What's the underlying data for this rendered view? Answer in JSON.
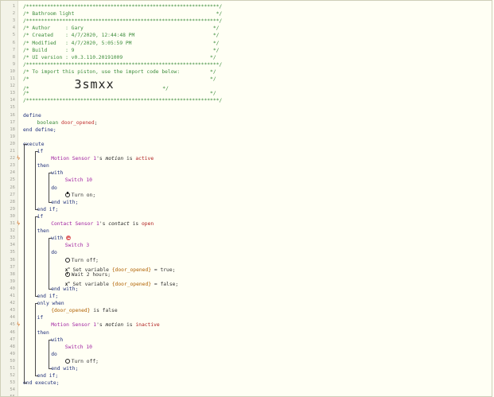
{
  "header": {
    "stars": "/****************************************************************/",
    "title": "/* Bathroom light                                               */",
    "author": "/* Author     : Gary                                           */",
    "created": "/* Created    : 4/7/2020, 12:44:48 PM                          */",
    "modified": "/* Modified   : 4/7/2020, 5:05:59 PM                           */",
    "build": "/* Build      : 9                                              */",
    "ui_version": "/* UI version : v0.3.110.20191009                             */",
    "import_note": "/* To import this piston, use the import code below:          */",
    "blank": "/*                                                            */",
    "import_prefix": "/*               ",
    "import_code": "3smxx",
    "import_suffix": "*/"
  },
  "code": {
    "define": "define",
    "boolean": "boolean",
    "door_opened": "door_opened",
    "semicolon": ";",
    "end_define": "end define;",
    "execute": "execute",
    "if": "if",
    "then": "then",
    "with": "with",
    "do": "do",
    "end_with": "end with;",
    "end_if": "end if;",
    "only_when": "only when",
    "end_execute": "end execute;",
    "motion_sensor": "Motion Sensor 1",
    "contact_sensor": "Contact Sensor 1",
    "possessive": "'s",
    "motion": "motion",
    "contact": "contact",
    "is": "is",
    "active": "active",
    "inactive": "inactive",
    "open": "open",
    "switch10": "Switch 10",
    "switch3": "Switch 3",
    "turn_on": "Turn on;",
    "turn_off": "Turn off;",
    "set_variable": "Set variable",
    "door_opened_expr": "{door_opened}",
    "eq_true": "= true;",
    "eq_false": "= false;",
    "wait": "Wait 2 hours;",
    "is_false": "is false"
  },
  "icons": {
    "trigger": "lightning-trigger-icon",
    "power": "power-icon",
    "clock": "clock-icon",
    "variable": "set-variable-icon",
    "restriction": "restriction-icon"
  },
  "line_numbers": [
    "1",
    "2",
    "3",
    "4",
    "5",
    "6",
    "7",
    "8",
    "9",
    "10",
    "11",
    "12",
    "13",
    "14",
    "15",
    "16",
    "17",
    "18",
    "19",
    "20",
    "21",
    "22",
    "23",
    "24",
    "25",
    "26",
    "27",
    "28",
    "29",
    "30",
    "31",
    "32",
    "33",
    "34",
    "35",
    "36",
    "37",
    "38",
    "39",
    "40",
    "41",
    "42",
    "43",
    "44",
    "45",
    "46",
    "47",
    "48",
    "49",
    "50",
    "51",
    "52",
    "53",
    "54",
    "55",
    "56",
    "57"
  ]
}
